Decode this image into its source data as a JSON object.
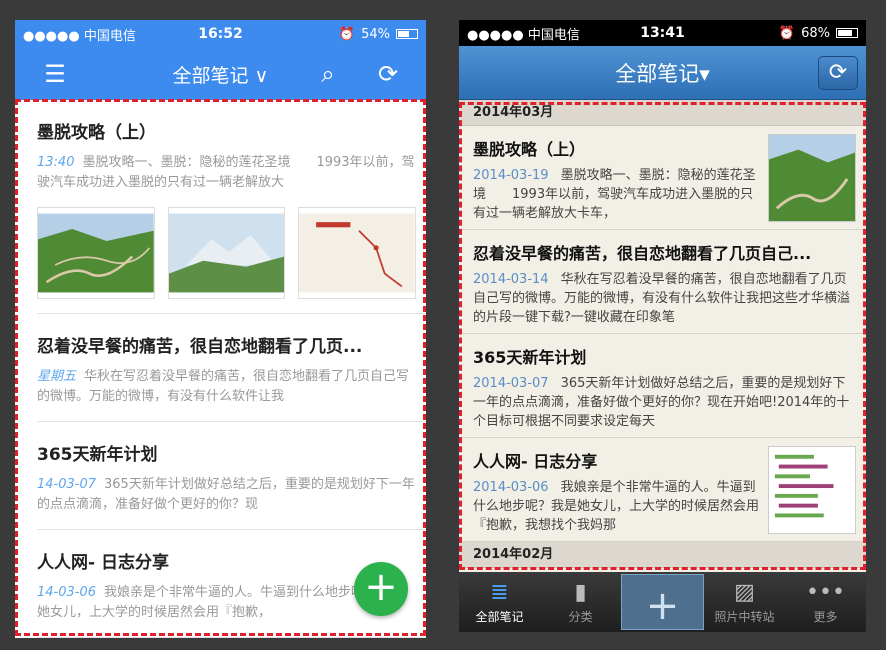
{
  "left": {
    "status": {
      "carrier": "●●●●● 中国电信",
      "time": "16:52",
      "battery": "54%",
      "battery_level": 0.54
    },
    "nav": {
      "title": "全部笔记 ∨"
    },
    "notes": [
      {
        "title": "墨脱攻略（上）",
        "date": "13:40",
        "snippet": "墨脱攻略一、墨脱：隐秘的莲花圣境　　1993年以前，驾驶汽车成功进入墨脱的只有过一辆老解放大"
      },
      {
        "title": "忍着没早餐的痛苦，很自恋地翻看了几页...",
        "date": "星期五",
        "snippet": "华秋在写忍着没早餐的痛苦，很自恋地翻看了几页自己写的微博。万能的微博，有没有什么软件让我"
      },
      {
        "title": "365天新年计划",
        "date": "14-03-07",
        "snippet": "365天新年计划做好总结之后，重要的是规划好下一年的点点滴滴，准备好做个更好的你？现"
      },
      {
        "title": "人人网- 日志分享",
        "date": "14-03-06",
        "snippet": "我娘亲是个非常牛逼的人。牛逼到什么地步呢？我是她女儿，上大学的时候居然会用『抱歉，"
      }
    ],
    "fab": "+"
  },
  "right": {
    "status": {
      "carrier": "●●●●● 中国电信",
      "time": "13:41",
      "battery": "68%",
      "battery_level": 0.68
    },
    "nav": {
      "title": "全部笔记▾"
    },
    "sections": {
      "s1": "2014年03月",
      "s2": "2014年02月"
    },
    "notes": [
      {
        "title": "墨脱攻略（上）",
        "date": "2014-03-19",
        "snippet": "墨脱攻略一、墨脱：隐秘的莲花圣境　　1993年以前，驾驶汽车成功进入墨脱的只有过一辆老解放大卡车，"
      },
      {
        "title": "忍着没早餐的痛苦，很自恋地翻看了几页自己...",
        "date": "2014-03-14",
        "snippet": "华秋在写忍着没早餐的痛苦，很自恋地翻看了几页自己写的微博。万能的微博，有没有什么软件让我把这些才华横溢的片段一键下载?一键收藏在印象笔"
      },
      {
        "title": "365天新年计划",
        "date": "2014-03-07",
        "snippet": "365天新年计划做好总结之后，重要的是规划好下一年的点点滴滴，准备好做个更好的你？现在开始吧!2014年的十个目标可根据不同要求设定每天"
      },
      {
        "title": "人人网- 日志分享",
        "date": "2014-03-06",
        "snippet": "我娘亲是个非常牛逼的人。牛逼到什么地步呢？我是她女儿，上大学的时候居然会用『抱歉，我想找个我妈那"
      }
    ],
    "tabs": [
      {
        "label": "全部笔记",
        "icon": "≣"
      },
      {
        "label": "分类",
        "icon": "▮"
      },
      {
        "label": "",
        "icon": "+"
      },
      {
        "label": "照片中转站",
        "icon": "▨"
      },
      {
        "label": "更多",
        "icon": "•••"
      }
    ]
  }
}
